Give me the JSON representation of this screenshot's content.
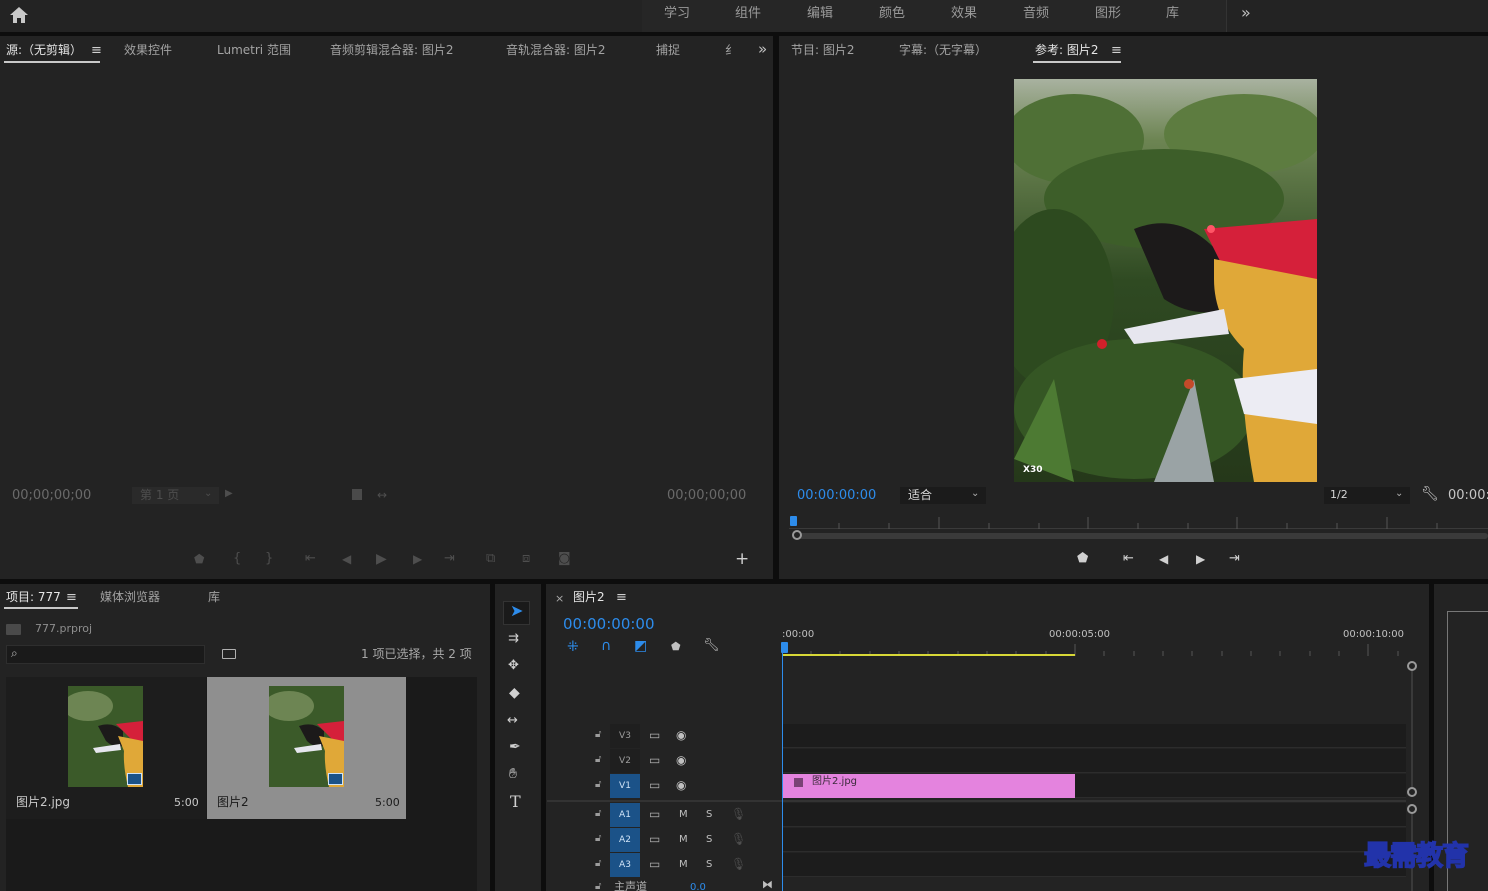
{
  "topbar": {
    "nav": [
      "学习",
      "组件",
      "编辑",
      "颜色",
      "效果",
      "音频",
      "图形",
      "库"
    ],
    "more": "»"
  },
  "source_panel": {
    "tabs": [
      "源:（无剪辑）",
      "效果控件",
      "Lumetri 范围",
      "音频剪辑混合器: 图片2",
      "音轨混合器: 图片2",
      "捕捉",
      "纟"
    ],
    "more": "»",
    "timecode_left": "00;00;00;00",
    "page": "第 1 页",
    "timecode_right": "00;00;00;00",
    "add": "+"
  },
  "program_panel": {
    "tabs": [
      "节目: 图片2",
      "字幕:（无字幕）",
      "参考: 图片2"
    ],
    "timecode": "00:00:00:00",
    "fit": "适合",
    "resolution": "1/2",
    "timecode_right": "00:00:",
    "watermark": "X30"
  },
  "project_panel": {
    "tabs": [
      "项目: 777",
      "媒体浏览器",
      "库"
    ],
    "file": "777.prproj",
    "search_placeholder": "",
    "selection_info": "1 项已选择，共 2 项",
    "items": [
      {
        "name": "图片2.jpg",
        "duration": "5:00",
        "selected": false
      },
      {
        "name": "图片2",
        "duration": "5:00",
        "selected": true
      }
    ]
  },
  "timeline": {
    "sequence_name": "图片2",
    "close": "×",
    "timecode": "00:00:00:00",
    "ruler": [
      ":00:00",
      "00:00:05:00",
      "00:00:10:00"
    ],
    "video_tracks": [
      "V3",
      "V2",
      "V1"
    ],
    "audio_tracks": [
      "A1",
      "A2",
      "A3"
    ],
    "master": "主声道",
    "master_value": "0.0",
    "clip": {
      "name": "图片2.jpg",
      "color": "#e483de"
    },
    "m_label": "M",
    "s_label": "S"
  },
  "watermark": {
    "text": "最需教育"
  },
  "colors": {
    "accent": "#2d8ceb",
    "clip": "#e483de",
    "work_area": "#d7d737",
    "track_on": "#1b5288"
  }
}
